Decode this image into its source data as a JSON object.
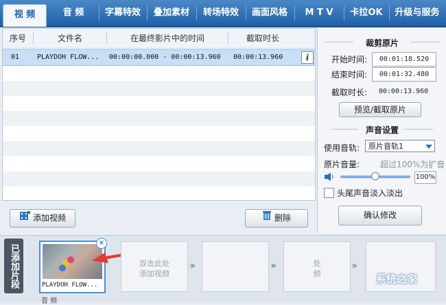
{
  "tabs": [
    "视 频",
    "音 频",
    "字幕特效",
    "叠加素材",
    "转场特效",
    "画面风格",
    "M T V",
    "卡拉OK",
    "升级与服务"
  ],
  "list": {
    "headers": [
      "序号",
      "文件名",
      "在最终影片中的时间",
      "截取时长"
    ],
    "rows": [
      {
        "index": "01",
        "filename": "PLAYDOH FLOW...",
        "time_range": "00:00:00.000 - 00:00:13.960",
        "duration": "00:00:13.960"
      }
    ]
  },
  "buttons": {
    "add_video": "添加视频",
    "delete": "删除",
    "preview_cut": "预览/截取原片",
    "confirm": "确认修改"
  },
  "cut_section": {
    "title": "裁剪原片",
    "start_label": "开始时间:",
    "start_value": "00:01:18.520",
    "end_label": "结束时间:",
    "end_value": "00:01:32.480",
    "duration_label": "截取时长:",
    "duration_value": "00:00:13.960"
  },
  "audio_section": {
    "title": "声音设置",
    "track_label": "使用音轨:",
    "track_value": "原片音轨1",
    "volume_label": "原片音量:",
    "volume_hint": "超过100%为扩音",
    "volume_value": "100%",
    "volume_level": 0.5,
    "fade_label": "头尾声音淡入淡出"
  },
  "timeline": {
    "label": "已添加片段",
    "clip_name": "PLAYDOH FLOW...",
    "placeholder_1": "双击此处\n添加视频",
    "placeholder_2": "处\n频",
    "audio_label": "音 频",
    "watermark": "系统之家"
  },
  "colors": {
    "accent": "#1f5fa6",
    "selection": "#c8dff7",
    "arrow": "#e53935"
  }
}
